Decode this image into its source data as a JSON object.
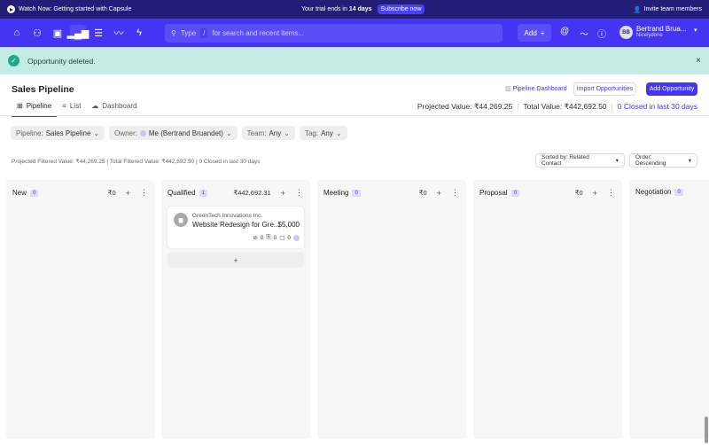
{
  "banner": {
    "watch": "Watch Now: Getting started with Capsule",
    "trial_prefix": "Your trial ends in ",
    "trial_days": "14 days",
    "subscribe": "Subscribe now",
    "invite": "Invite team members"
  },
  "nav": {
    "search_type": "Type",
    "search_slash": "/",
    "search_placeholder": "for search and recent items...",
    "add": "Add",
    "add_plus": "+",
    "user_name": "Bertrand Brua...",
    "user_org": "Nicelydone",
    "avatar": "BB"
  },
  "toast": {
    "message": "Opportunity deleted.",
    "check": "✓",
    "close": "×"
  },
  "page": {
    "title": "Sales Pipeline",
    "tabs": [
      {
        "label": "Pipeline",
        "icon": "⊞"
      },
      {
        "label": "List",
        "icon": "≡"
      },
      {
        "label": "Dashboard",
        "icon": "☁"
      }
    ],
    "pipeline_dashboard": "Pipeline Dashboard",
    "import": "Import Opportunities",
    "add_opportunity": "Add Opportunity",
    "projected_value": "Projected Value: ₹44,269.25",
    "total_value": "Total Value: ₹442,692.50",
    "closed": "0 Closed in last 30 days"
  },
  "filters": [
    {
      "label": "Pipeline:",
      "value": "Sales Pipeline"
    },
    {
      "label": "Owner:",
      "value": "Me (Bertrand Bruandet)"
    },
    {
      "label": "Team:",
      "value": "Any"
    },
    {
      "label": "Tag:",
      "value": "Any"
    }
  ],
  "stats": "Projected Filtered Value: ₹44,269.25 | Total Filtered Value: ₹442,692.50 | 0 Closed in last 30 days",
  "sort": {
    "sorted_by": "Sorted by: Related Contact",
    "order": "Order: Descending"
  },
  "columns": [
    {
      "name": "New",
      "count": "0",
      "amount": "₹0"
    },
    {
      "name": "Qualified",
      "count": "1",
      "amount": "₹442,692.31",
      "card": {
        "company": "GreenTech Innovations Inc.",
        "name": "Website Redesign for Gre...",
        "value": "$5,000",
        "tasks": "0",
        "attachments": "0",
        "notes": "0"
      }
    },
    {
      "name": "Meeting",
      "count": "0",
      "amount": "₹0"
    },
    {
      "name": "Proposal",
      "count": "0",
      "amount": "₹0"
    },
    {
      "name": "Negotiation",
      "count": "0",
      "amount": ""
    }
  ]
}
